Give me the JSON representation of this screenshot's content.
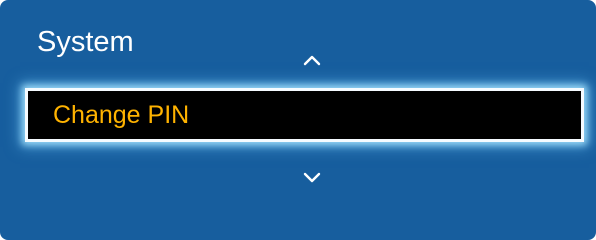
{
  "menu": {
    "title": "System",
    "selected_item": "Change PIN",
    "up_icon": "chevron-up-icon",
    "down_icon": "chevron-down-icon"
  },
  "colors": {
    "panel_background": "#175e9e",
    "selected_background": "#000000",
    "selected_text": "#ffb300",
    "focus_border": "#f5fbff",
    "title_text": "#ffffff"
  }
}
